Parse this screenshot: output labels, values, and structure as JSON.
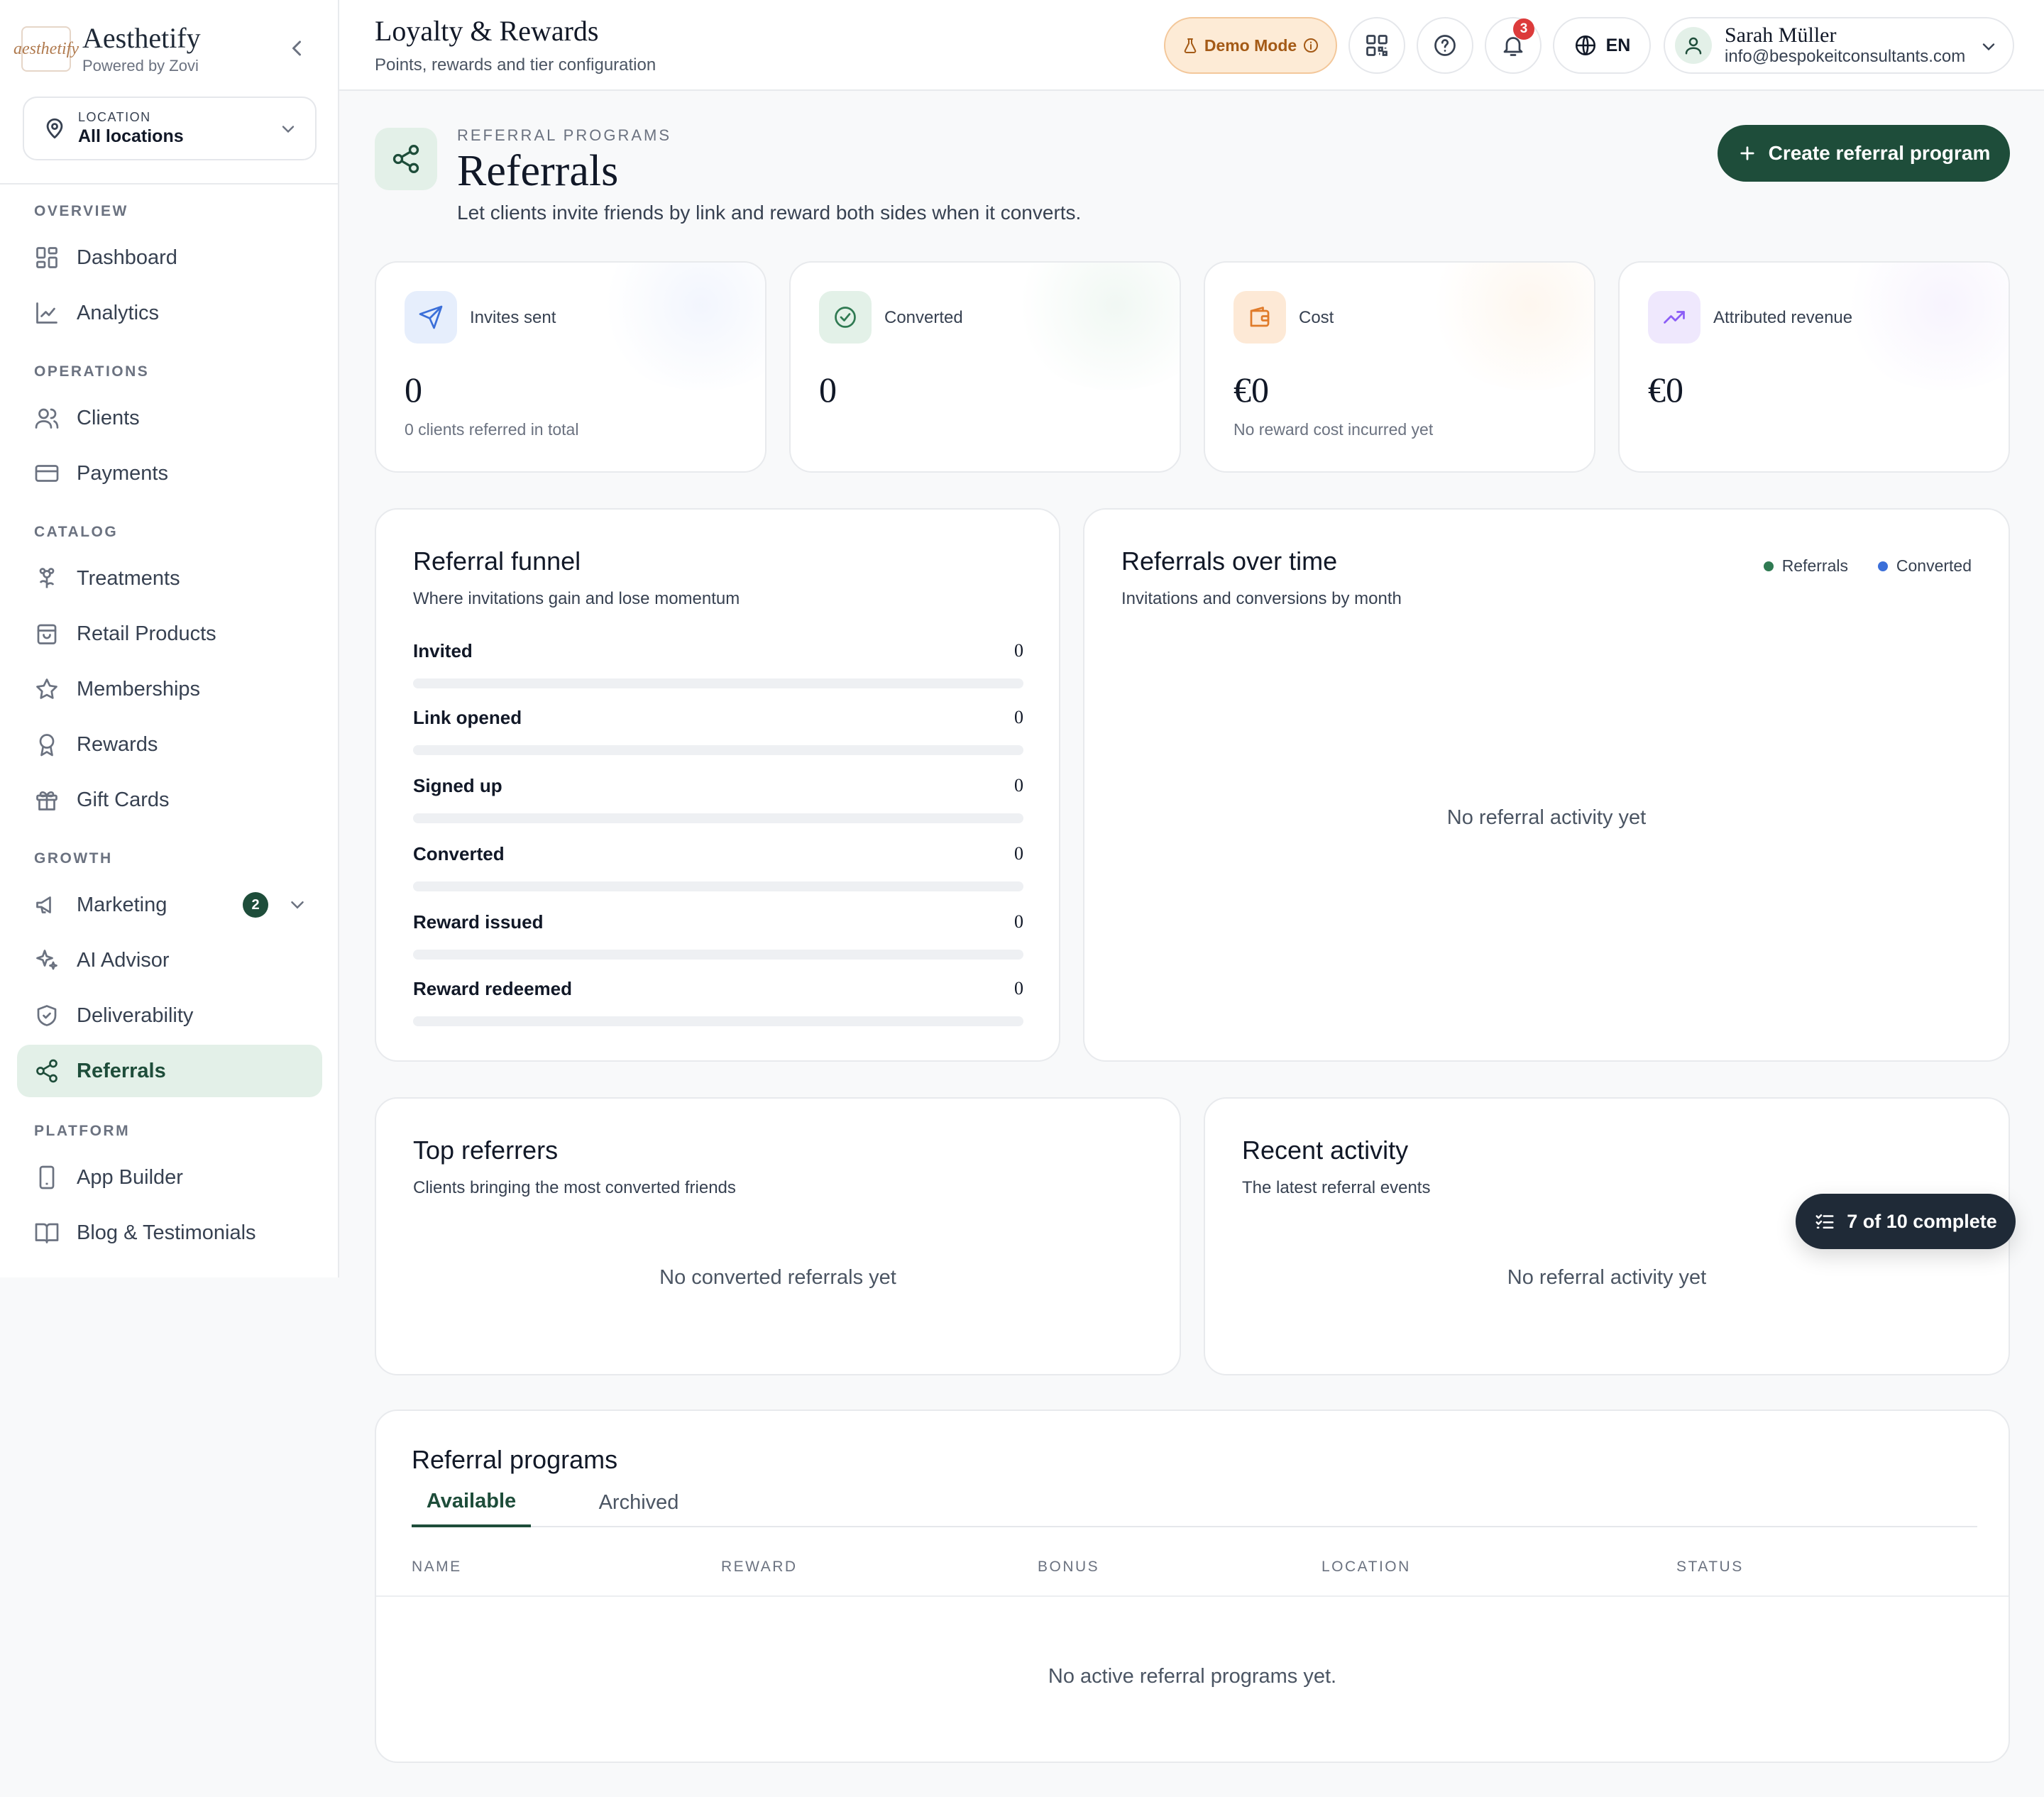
{
  "brand": {
    "logo_text": "aesthetify",
    "name": "Aesthetify",
    "sub": "Powered by Zovi"
  },
  "location": {
    "label": "LOCATION",
    "value": "All locations"
  },
  "sidebar": {
    "sections": [
      "OVERVIEW",
      "OPERATIONS",
      "CATALOG",
      "GROWTH",
      "PLATFORM"
    ],
    "items": [
      {
        "label": "Dashboard",
        "icon": "grid-icon"
      },
      {
        "label": "Analytics",
        "icon": "line-chart-icon"
      },
      {
        "label": "Clients",
        "icon": "users-icon"
      },
      {
        "label": "Payments",
        "icon": "credit-card-icon"
      },
      {
        "label": "Treatments",
        "icon": "flower-icon"
      },
      {
        "label": "Retail Products",
        "icon": "shopping-bag-icon"
      },
      {
        "label": "Memberships",
        "icon": "star-icon"
      },
      {
        "label": "Rewards",
        "icon": "award-icon"
      },
      {
        "label": "Gift Cards",
        "icon": "gift-icon"
      },
      {
        "label": "Marketing",
        "icon": "megaphone-icon",
        "badge": "2"
      },
      {
        "label": "AI Advisor",
        "icon": "sparkles-icon"
      },
      {
        "label": "Deliverability",
        "icon": "shield-icon"
      },
      {
        "label": "Referrals",
        "icon": "share-icon",
        "active": true
      },
      {
        "label": "App Builder",
        "icon": "smartphone-icon"
      },
      {
        "label": "Blog & Testimonials",
        "icon": "book-icon"
      }
    ]
  },
  "topbar": {
    "title": "Loyalty & Rewards",
    "subtitle": "Points, rewards and tier configuration",
    "demo_label": "Demo Mode",
    "notifications_count": "3",
    "language": "EN",
    "user_name": "Sarah Müller",
    "user_email": "info@bespokeitconsultants.com"
  },
  "header": {
    "eyebrow": "REFERRAL PROGRAMS",
    "title": "Referrals",
    "description": "Let clients invite friends by link and reward both sides when it converts.",
    "create_label": "Create referral program"
  },
  "stats": [
    {
      "label": "Invites sent",
      "value": "0",
      "note": "0 clients referred in total",
      "icon": "send-icon",
      "color": "#3b6fd9"
    },
    {
      "label": "Converted",
      "value": "0",
      "note": "",
      "icon": "check-circle-icon",
      "color": "#2f7a52"
    },
    {
      "label": "Cost",
      "value": "€0",
      "note": "No reward cost incurred yet",
      "icon": "wallet-icon",
      "color": "#e07b2a"
    },
    {
      "label": "Attributed revenue",
      "value": "€0",
      "note": "",
      "icon": "trending-up-icon",
      "color": "#8b5cf6"
    }
  ],
  "funnel": {
    "title": "Referral funnel",
    "subtitle": "Where invitations gain and lose momentum",
    "rows": [
      {
        "label": "Invited",
        "value": "0",
        "fraction": 0
      },
      {
        "label": "Link opened",
        "value": "0",
        "fraction": 0
      },
      {
        "label": "Signed up",
        "value": "0",
        "fraction": 0
      },
      {
        "label": "Converted",
        "value": "0",
        "fraction": 0
      },
      {
        "label": "Reward issued",
        "value": "0",
        "fraction": 0
      },
      {
        "label": "Reward redeemed",
        "value": "0",
        "fraction": 0
      }
    ]
  },
  "over_time": {
    "title": "Referrals over time",
    "subtitle": "Invitations and conversions by month",
    "legend": [
      {
        "name": "Referrals",
        "color": "#2f7a52"
      },
      {
        "name": "Converted",
        "color": "#3b6fd9"
      }
    ],
    "empty": "No referral activity yet"
  },
  "top_referrers": {
    "title": "Top referrers",
    "subtitle": "Clients bringing the most converted friends",
    "empty": "No converted referrals yet"
  },
  "recent_activity": {
    "title": "Recent activity",
    "subtitle": "The latest referral events",
    "empty": "No referral activity yet"
  },
  "checklist": {
    "label": "7 of 10 complete"
  },
  "programs": {
    "title": "Referral programs",
    "tabs": [
      "Available",
      "Archived"
    ],
    "columns": [
      "NAME",
      "REWARD",
      "BONUS",
      "LOCATION",
      "STATUS"
    ],
    "empty": "No active referral programs yet."
  }
}
